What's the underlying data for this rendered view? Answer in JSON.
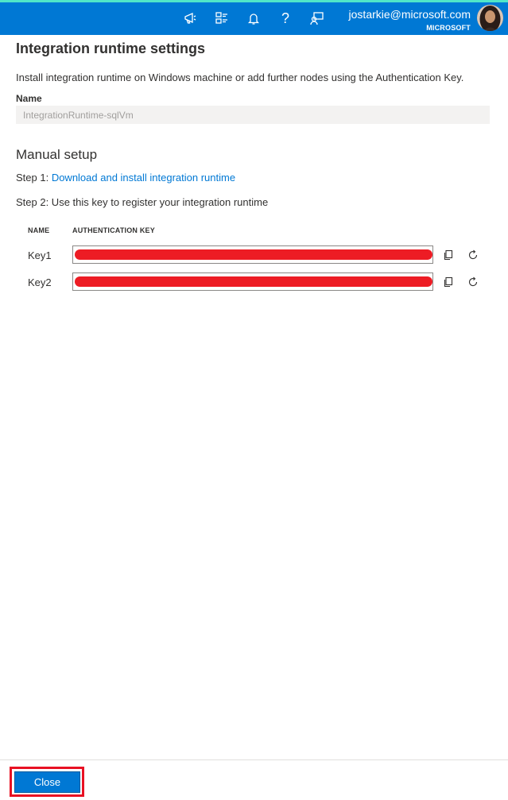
{
  "header": {
    "icons": [
      "feedback-megaphone-icon",
      "directory-filter-icon",
      "notifications-bell-icon",
      "help-icon",
      "feedback-person-icon"
    ],
    "help_glyph": "?",
    "user_email": "jostarkie@microsoft.com",
    "user_org": "MICROSOFT",
    "accent_color": "#0078d4",
    "top_stripe_color": "#50e6c8"
  },
  "panel": {
    "title": "Integration runtime settings",
    "description": "Install integration runtime on Windows machine or add further nodes using the Authentication Key.",
    "name_label": "Name",
    "name_value": "IntegrationRuntime-sqlVm",
    "section_title": "Manual setup",
    "step1_prefix": "Step 1: ",
    "step1_link": "Download and install integration runtime",
    "step2_text": "Step 2: Use this key to register your integration runtime",
    "table": {
      "col_name": "NAME",
      "col_key": "AUTHENTICATION KEY",
      "rows": [
        {
          "name": "Key1",
          "redacted_color": "#ed1c24"
        },
        {
          "name": "Key2",
          "redacted_color": "#ed1c24"
        }
      ],
      "row_actions": [
        "copy-icon",
        "refresh-icon"
      ]
    }
  },
  "footer": {
    "close_label": "Close",
    "highlight_color": "#e81123"
  }
}
